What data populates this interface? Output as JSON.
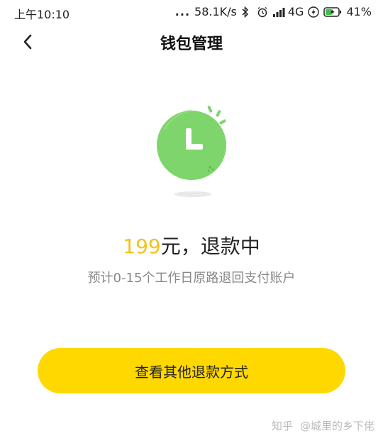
{
  "status_bar": {
    "time": "上午10:10",
    "dots": "...",
    "speed": "58.1K/s",
    "network": "4G",
    "battery": "41%"
  },
  "header": {
    "title": "钱包管理"
  },
  "result": {
    "amount": "199",
    "text": "元，退款中",
    "subtext": "预计0-15个工作日原路退回支付账户"
  },
  "actions": {
    "other_refund_label": "查看其他退款方式"
  },
  "watermark": {
    "site": "知乎",
    "user": "@城里的乡下佬"
  },
  "colors": {
    "accent_yellow": "#ffd800",
    "amount_yellow": "#f4c21a",
    "clock_green": "#7ed56b"
  },
  "icons": [
    "back-arrow-icon",
    "bluetooth-icon",
    "alarm-icon",
    "signal-icon",
    "flash-icon",
    "battery-icon",
    "clock-icon"
  ]
}
